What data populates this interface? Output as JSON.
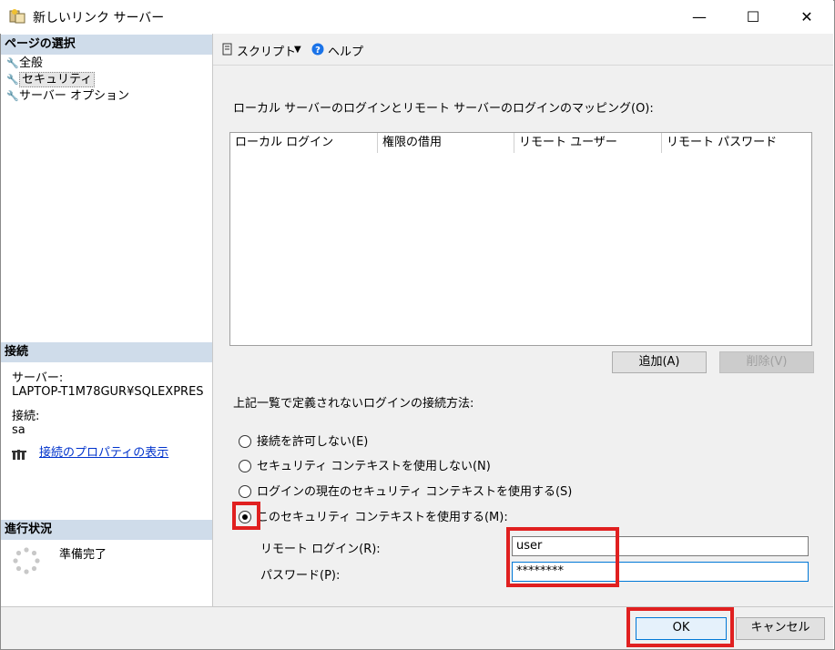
{
  "window": {
    "title": "新しいリンク サーバー",
    "controls": {
      "minimize": "—",
      "maximize": "☐",
      "close": "✕"
    }
  },
  "left_panel": {
    "page_select_header": "ページの選択",
    "nav_items": [
      {
        "label": "全般"
      },
      {
        "label": "セキュリティ"
      },
      {
        "label": "サーバー オプション"
      }
    ],
    "connection_header": "接続",
    "server_label": "サーバー:",
    "server_value": "LAPTOP-T1M78GUR¥SQLEXPRES",
    "connection_label": "接続:",
    "connection_value": "sa",
    "properties_link": "接続のプロパティの表示",
    "progress_header": "進行状況",
    "progress_status": "準備完了"
  },
  "toolbar": {
    "script_label": "スクリプト",
    "help_label": "ヘルプ"
  },
  "mapping": {
    "label": "ローカル サーバーのログインとリモート サーバーのログインのマッピング(O):",
    "columns": [
      "ローカル ログイン",
      "権限の借用",
      "リモート ユーザー",
      "リモート パスワード"
    ],
    "add_button": "追加(A)",
    "remove_button": "削除(V)"
  },
  "undefined_logins": {
    "label": "上記一覧で定義されないログインの接続方法:",
    "options": [
      {
        "label": "接続を許可しない(E)",
        "checked": false
      },
      {
        "label": "セキュリティ コンテキストを使用しない(N)",
        "checked": false
      },
      {
        "label": "ログインの現在のセキュリティ コンテキストを使用する(S)",
        "checked": false
      },
      {
        "label": "このセキュリティ コンテキストを使用する(M):",
        "checked": true
      }
    ],
    "remote_login_label": "リモート ログイン(R):",
    "remote_login_value": "user",
    "password_label": "パスワード(P):",
    "password_value": "********"
  },
  "footer": {
    "ok_button": "OK",
    "cancel_button": "キャンセル"
  },
  "colors": {
    "section_header_bg": "#cfdcea",
    "highlight": "#e02020",
    "focus_border": "#0078d7"
  }
}
